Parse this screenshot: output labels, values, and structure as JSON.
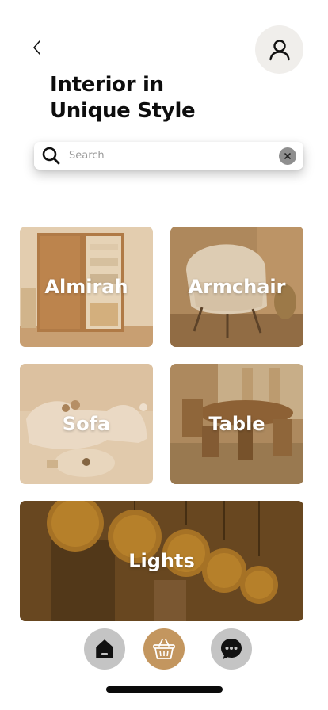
{
  "header": {
    "back_icon": "chevron-left-icon",
    "profile_icon": "user-icon",
    "title_line1": "Interior in",
    "title_line2": "Unique Style"
  },
  "search": {
    "placeholder": "Search",
    "value": "",
    "icon": "search-icon",
    "clear_icon": "close-icon"
  },
  "categories": [
    {
      "label": "Almirah"
    },
    {
      "label": "Armchair"
    },
    {
      "label": "Sofa"
    },
    {
      "label": "Table"
    },
    {
      "label": "Lights"
    }
  ],
  "bottom_nav": {
    "home_icon": "home-icon",
    "cart_icon": "basket-icon",
    "chat_icon": "chat-bubble-icon"
  },
  "colors": {
    "accent": "#c3965f",
    "card_tint": "#a87a45",
    "nav_inactive": "#c4c4c4",
    "profile_bg": "#f0eeeb",
    "text_primary": "#0d0d0d"
  }
}
